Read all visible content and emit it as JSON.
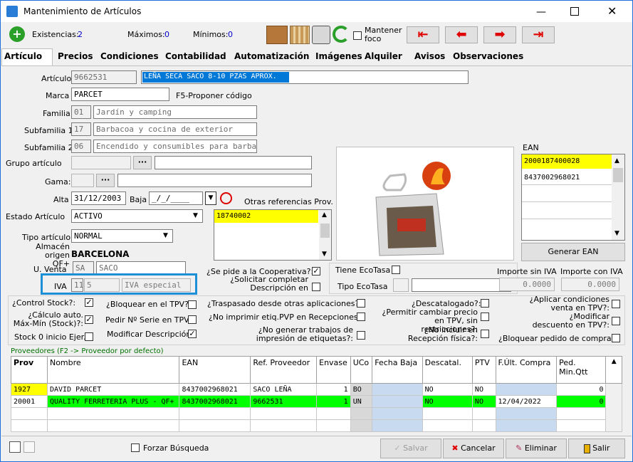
{
  "window": {
    "title": "Mantenimiento de Artículos"
  },
  "toolbar": {
    "existencias_label": "Existencias:",
    "existencias_value": "2",
    "maximos_label": "Máximos:",
    "maximos_value": "0",
    "minimos_label": "Mínimos:",
    "minimos_value": "0",
    "mantener_foco": "Mantener foco"
  },
  "tabs": [
    "Artículo",
    "Precios",
    "Condiciones",
    "Contabilidad",
    "Automatización",
    "Imágenes",
    "Alquiler",
    "Avisos",
    "Observaciones"
  ],
  "form": {
    "articulo_label": "Artículo",
    "articulo_code": "9662531",
    "articulo_desc": "LEÑA SECA SACO 8-10 PZAS APROX.",
    "marca_label": "Marca",
    "marca_value": "PARCET",
    "marca_hint": "F5-Proponer código",
    "familia_label": "Familia",
    "familia_code": "01",
    "familia_desc": "Jardín y camping",
    "subfamilia1_label": "Subfamilia 1",
    "subfamilia1_code": "17",
    "subfamilia1_desc": "Barbacoa y cocina de exterior",
    "subfamilia2_label": "Subfamilia 2",
    "subfamilia2_code": "06",
    "subfamilia2_desc": "Encendido y consumibles para barbac",
    "grupo_label": "Grupo artículo",
    "gama_label": "Gama:",
    "alta_label": "Alta",
    "alta_value": "31/12/2003",
    "baja_label": "Baja",
    "baja_value": "_/_/____",
    "otras_ref_label": "Otras referencias Prov.",
    "otras_ref_items": [
      "18740002"
    ],
    "estado_label": "Estado Artículo",
    "estado_value": "ACTIVO",
    "tipo_label": "Tipo artículo",
    "tipo_value": "NORMAL",
    "almacen_label": "Almacén origen QF+",
    "almacen_value": "BARCELONA",
    "uventa_label": "U. Venta",
    "uventa_code": "SA",
    "uventa_desc": "SACO",
    "iva_label": "IVA",
    "iva_code": "11",
    "iva_pct": "5",
    "iva_desc": "IVA especial"
  },
  "ean": {
    "label": "EAN",
    "items": [
      "2000187400028",
      "8437002968021"
    ],
    "generar": "Generar EAN"
  },
  "flags": {
    "cooperativa": "¿Se pide a la Cooperativa?:",
    "solicitar": "¿Solicitar completar Descripción en",
    "tiene_ecotasa": "Tiene EcoTasa",
    "tipo_ecotasa": "Tipo EcoTasa",
    "importe_sin_iva_label": "Importe sin IVA",
    "importe_sin_iva": "0.0000",
    "importe_con_iva_label": "Importe con IVA",
    "importe_con_iva": "0.0000",
    "control_stock": "¿Control Stock?:",
    "bloquear_tpv": "¿Bloquear en el TPV?:",
    "traspasado": "¿Traspasado desde otras aplicaciones?:",
    "descatalogado": "¿Descatalogado?:",
    "aplicar_cond": "¿Aplicar condiciones venta en TPV?:",
    "calculo_auto": "¿Cálculo auto. Máx-Mín (Stock)?:",
    "pedir_serie": "Pedir Nº Serie en TPV:",
    "no_imprimir": "¿No imprimir etiq.PVP en Recepciones?:",
    "permitir_precio": "¿Permitir cambiar precio en TPV, sin restricciones?:",
    "modificar_desc": "¿Modificar descuento en TPV?:",
    "stock0": "Stock 0 inicio Ejer.",
    "modificar_descripcion": "Modificar Descripción:",
    "no_generar": "¿No generar trabajos de impresión de etiquetas?:",
    "no_incluir": "¿No incluir en Recepción física?:",
    "bloquear_pedido": "¿Bloquear pedido de compra?:"
  },
  "proveedores": {
    "caption": "Proveedores (F2 -> Proveedor por defecto)",
    "columns": [
      "Prov",
      "Nombre",
      "EAN",
      "Ref. Proveedor",
      "Envase",
      "UCo",
      "Fecha Baja",
      "Descatal.",
      "PTV",
      "F.Últ. Compra",
      "Ped. Min.Qtt"
    ],
    "rows": [
      [
        "1927",
        "DAVID PARCET",
        "8437002968021",
        "SACO LEÑA",
        "1",
        "BO",
        "",
        "NO",
        "NO",
        "",
        "0"
      ],
      [
        "20001",
        "QUALITY FERRETERIA PLUS - QF+",
        "8437002968021",
        "9662531",
        "1",
        "UN",
        "",
        "NO",
        "NO",
        "12/04/2022",
        "0"
      ]
    ]
  },
  "footer": {
    "forzar": "Forzar Búsqueda",
    "salvar": "Salvar",
    "cancelar": "Cancelar",
    "eliminar": "Eliminar",
    "salir": "Salir"
  },
  "colors": {
    "accent_box": "#1c8fd6",
    "highlight_yellow": "#ffff00",
    "highlight_green": "#00ff00",
    "selection_blue": "#0078d7"
  }
}
